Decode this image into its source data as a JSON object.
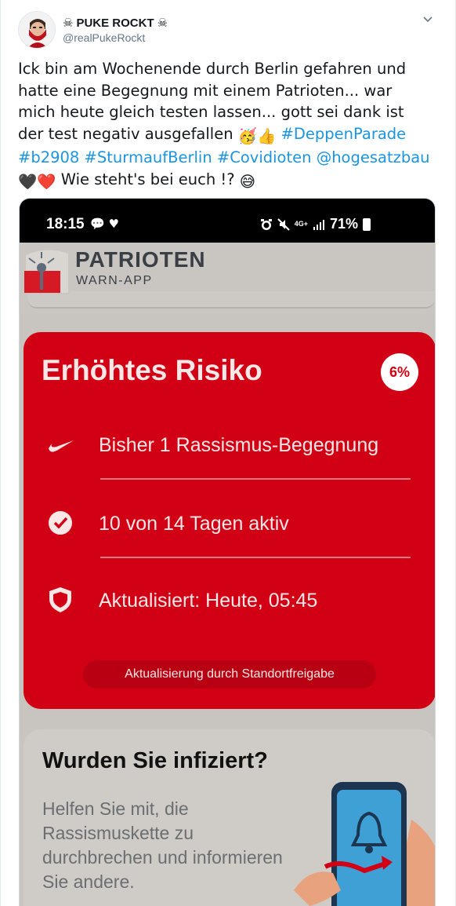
{
  "tweet": {
    "display_name": "PUKE ROCKT",
    "name_icon": "skull-crossbones-icon",
    "handle": "@realPukeRockt",
    "text_segments": [
      {
        "type": "text",
        "value": "Ick bin am Wochenende durch Berlin gefahren und hatte eine Begegnung mit einem Patrioten... war mich heute gleich testen lassen... gott sei dank ist der test negativ ausgefallen "
      },
      {
        "type": "emoji",
        "value": "🥳👍"
      },
      {
        "type": "text",
        "value": " "
      },
      {
        "type": "hashtag",
        "value": "#DeppenParade"
      },
      {
        "type": "text",
        "value": " "
      },
      {
        "type": "hashtag",
        "value": "#b2908"
      },
      {
        "type": "text",
        "value": " "
      },
      {
        "type": "hashtag",
        "value": "#SturmaufBerlin"
      },
      {
        "type": "text",
        "value": " "
      },
      {
        "type": "hashtag",
        "value": "#Covidioten"
      },
      {
        "type": "text",
        "value": "  "
      },
      {
        "type": "mention",
        "value": "@hogesatzbau"
      },
      {
        "type": "text",
        "value": " "
      },
      {
        "type": "emoji",
        "value": "🖤❤️"
      },
      {
        "type": "text",
        "value": " Wie steht's bei euch !? "
      },
      {
        "type": "emoji",
        "value": "😅"
      }
    ],
    "link_color": "#1b95e0"
  },
  "phone": {
    "status_bar": {
      "time": "18:15",
      "left_icons": "💬 ♥",
      "signal_label_top": "4G+",
      "battery": "71%"
    },
    "app": {
      "logo_title": "PATRIOTEN",
      "logo_subtitle": "WARN-APP",
      "risk_card": {
        "title": "Erhöhtes Risiko",
        "badge": "6%",
        "rows": [
          {
            "icon": "swoosh-icon",
            "text": "Bisher 1 Rassismus-Begegnung"
          },
          {
            "icon": "check-circle-icon",
            "text": "10 von 14 Tagen aktiv"
          },
          {
            "icon": "shield-icon",
            "text": "Aktualisiert: Heute, 05:45"
          }
        ],
        "button": "Aktualisierung durch Standortfreigabe",
        "color": "#d20015"
      },
      "info_card": {
        "title": "Wurden Sie infiziert?",
        "body": "Helfen Sie mit, die Rassismuskette zu durchbrechen und informieren Sie andere."
      }
    }
  }
}
